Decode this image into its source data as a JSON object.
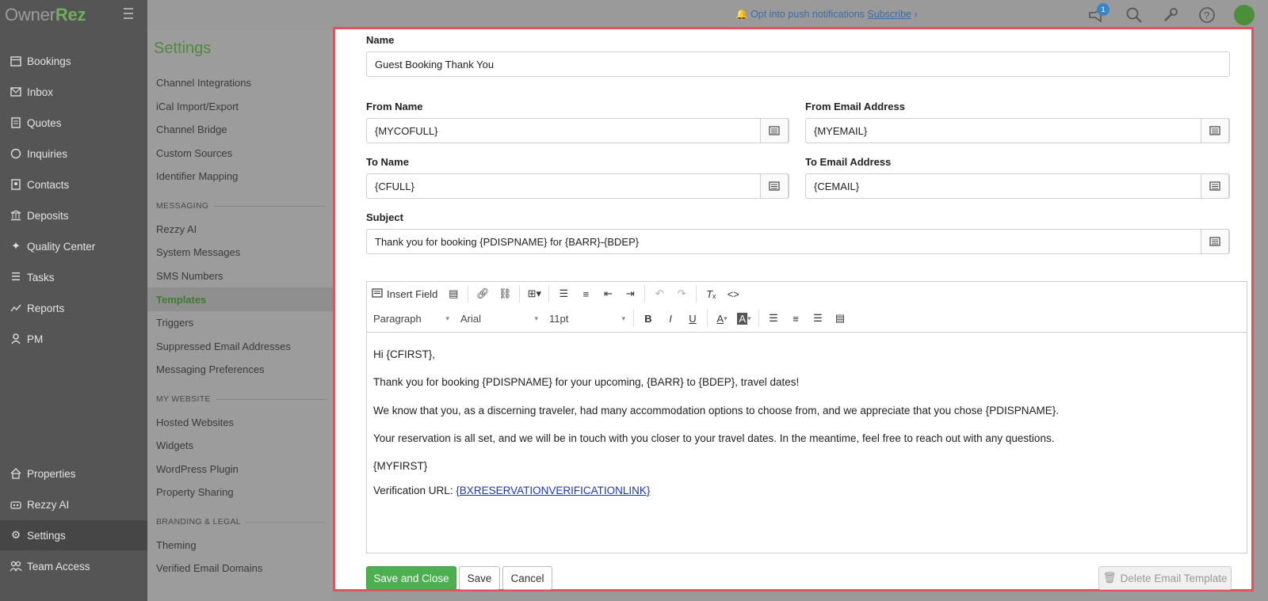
{
  "app": {
    "logo_part1": "Owner",
    "logo_part2": "Rez"
  },
  "sidebar": {
    "items": [
      {
        "label": "Bookings",
        "icon": "calendar-icon"
      },
      {
        "label": "Inbox",
        "icon": "envelope-icon"
      },
      {
        "label": "Quotes",
        "icon": "document-icon"
      },
      {
        "label": "Inquiries",
        "icon": "chat-icon"
      },
      {
        "label": "Contacts",
        "icon": "contact-card-icon"
      },
      {
        "label": "Deposits",
        "icon": "bank-icon"
      },
      {
        "label": "Quality Center",
        "icon": "sparkle-icon"
      },
      {
        "label": "Tasks",
        "icon": "checklist-icon"
      },
      {
        "label": "Reports",
        "icon": "chart-icon"
      },
      {
        "label": "PM",
        "icon": "person-icon"
      }
    ],
    "bottom_items": [
      {
        "label": "Properties",
        "icon": "home-icon"
      },
      {
        "label": "Rezzy AI",
        "icon": "robot-icon"
      },
      {
        "label": "Settings",
        "icon": "gear-icon"
      },
      {
        "label": "Team Access",
        "icon": "team-icon"
      }
    ]
  },
  "settings": {
    "title": "Settings",
    "items": [
      "Channel Integrations",
      "iCal Import/Export",
      "Channel Bridge",
      "Custom Sources",
      "Identifier Mapping"
    ],
    "messaging_header": "MESSAGING",
    "messaging_items": [
      "Rezzy AI",
      "System Messages",
      "SMS Numbers",
      "Templates",
      "Triggers",
      "Suppressed Email Addresses",
      "Messaging Preferences"
    ],
    "website_header": "MY WEBSITE",
    "website_items": [
      "Hosted Websites",
      "Widgets",
      "WordPress Plugin",
      "Property Sharing"
    ],
    "branding_header": "BRANDING & LEGAL",
    "branding_items": [
      "Theming",
      "Verified Email Domains"
    ]
  },
  "topbar": {
    "push_text": "Opt into push notifications",
    "push_link": "Subscribe",
    "notification_count": "1"
  },
  "form": {
    "name_label": "Name",
    "name_value": "Guest Booking Thank You",
    "from_name_label": "From Name",
    "from_name_value": "{MYCOFULL}",
    "from_email_label": "From Email Address",
    "from_email_value": "{MYEMAIL}",
    "to_name_label": "To Name",
    "to_name_value": "{CFULL}",
    "to_email_label": "To Email Address",
    "to_email_value": "{CEMAIL}",
    "subject_label": "Subject",
    "subject_value": "Thank you for booking {PDISPNAME}  for {BARR}-{BDEP}"
  },
  "editor": {
    "insert_field": "Insert Field",
    "format_value": "Paragraph",
    "font_value": "Arial",
    "size_value": "11pt",
    "body": {
      "greeting": "Hi {CFIRST},",
      "line1": "Thank you for booking {PDISPNAME} for your upcoming, {BARR} to {BDEP}, travel dates!",
      "line2": "We know that you, as a discerning traveler, had many accommodation options to choose from, and we appreciate that you chose {PDISPNAME}.",
      "line3": "Your reservation is all set, and we will be in touch with you closer to your travel dates. In the meantime, feel free to reach out with any questions.",
      "signature": "{MYFIRST}",
      "verification_label": "Verification URL: ",
      "verification_link": "{BXRESERVATIONVERIFICATIONLINK}"
    }
  },
  "actions": {
    "save_close": "Save and Close",
    "save": "Save",
    "cancel": "Cancel",
    "delete": "Delete Email Template"
  },
  "colors": {
    "brand_green": "#4caf50",
    "modal_border": "#e0555d",
    "link_blue": "#1a35cc"
  }
}
